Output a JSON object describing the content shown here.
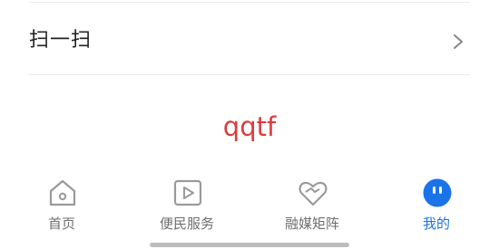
{
  "menu": {
    "scan_label": "扫一扫",
    "chevron_icon": "chevron-right-icon"
  },
  "brand": {
    "text": "qqtf",
    "color": "#dd3b3b"
  },
  "tabbar": {
    "active_color": "#1a73e8",
    "inactive_color": "#6f6f6f",
    "tabs": [
      {
        "label": "首页",
        "icon": "home-icon",
        "active": false
      },
      {
        "label": "便民服务",
        "icon": "play-square-icon",
        "active": false
      },
      {
        "label": "融媒矩阵",
        "icon": "heart-outline-icon",
        "active": false
      },
      {
        "label": "我的",
        "icon": "profile-face-icon",
        "active": true
      }
    ]
  }
}
